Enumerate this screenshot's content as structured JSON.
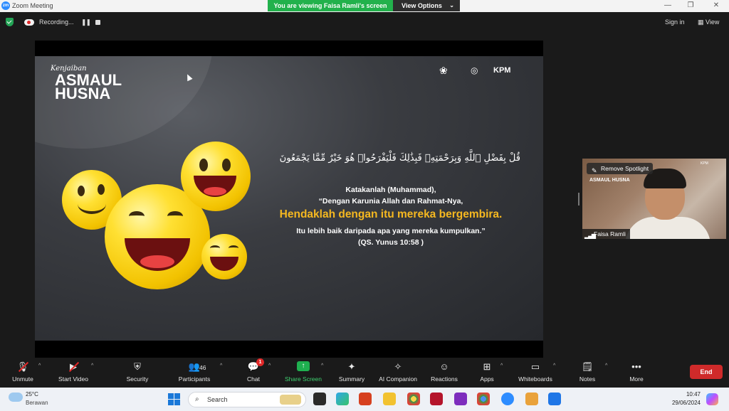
{
  "window": {
    "title": "Zoom Meeting",
    "app_icon": "zm",
    "banner": "You are viewing Faisa Ramli's screen",
    "view_options": "View Options"
  },
  "topbar": {
    "recording": "Recording...",
    "signin": "Sign in",
    "view": "View"
  },
  "slide": {
    "brand_top": "Kenjaiban",
    "brand_line1": "ASMAUL",
    "brand_line2": "HUSNA",
    "logo_text": "KPM",
    "arabic": "قُلْ بِفَضْلِ ٱللَّهِ وَبِرَحْمَتِهِۦ فَبِذَٰلِكَ فَلْيَفْرَحُوا۟ هُوَ خَيْرٌ مِّمَّا يَجْمَعُونَ",
    "line1": "Katakanlah (Muhammad),",
    "line2": "“Dengan Karunia Allah dan Rahmat-Nya,",
    "highlight": "Hendaklah dengan itu mereka bergembira.",
    "line4": "Itu lebih baik daripada apa yang mereka kumpulkan.”",
    "line5": "(QS. Yunus 10:58 )"
  },
  "video": {
    "spotlight_label": "Remove Spotlight",
    "name": "Faisa Ramli",
    "mini_title": "ASMAUL HUSNA",
    "mini_logo": "KPM"
  },
  "toolbar": {
    "unmute": "Unmute",
    "start_video": "Start Video",
    "security": "Security",
    "participants": "Participants",
    "participants_count": "46",
    "chat": "Chat",
    "chat_badge": "1",
    "share_screen": "Share Screen",
    "summary": "Summary",
    "ai_companion": "AI Companion",
    "reactions": "Reactions",
    "apps": "Apps",
    "whiteboards": "Whiteboards",
    "notes": "Notes",
    "more": "More",
    "end": "End"
  },
  "taskbar": {
    "temperature": "25°C",
    "condition": "Berawan",
    "search_placeholder": "Search",
    "time": "10:47",
    "date": "29/06/2024"
  },
  "colors": {
    "share_green": "#22b14c",
    "end_red": "#cf2a2a",
    "highlight_gold": "#f5b820",
    "zoom_blue": "#2d8cff"
  }
}
